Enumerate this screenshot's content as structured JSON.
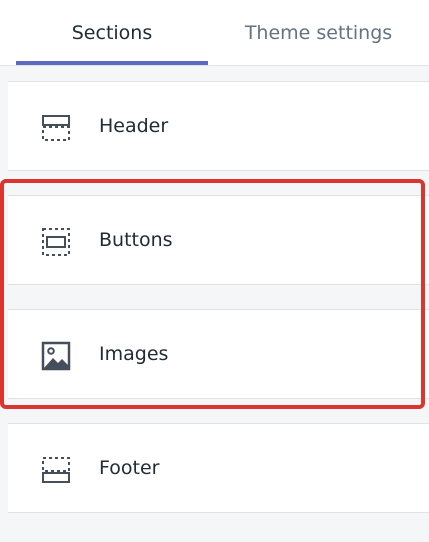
{
  "tabs": [
    {
      "label": "Sections",
      "active": true
    },
    {
      "label": "Theme settings",
      "active": false
    }
  ],
  "sections": [
    {
      "label": "Header",
      "icon": "header-layout-icon"
    },
    {
      "label": "Buttons",
      "icon": "button-layout-icon"
    },
    {
      "label": "Images",
      "icon": "image-icon"
    },
    {
      "label": "Footer",
      "icon": "footer-layout-icon"
    }
  ],
  "colors": {
    "tab_active_underline": "#5c6ac4",
    "highlight_border": "#d9362f",
    "text_primary": "#212b36",
    "text_secondary": "#637381",
    "background": "#f4f6f8"
  }
}
